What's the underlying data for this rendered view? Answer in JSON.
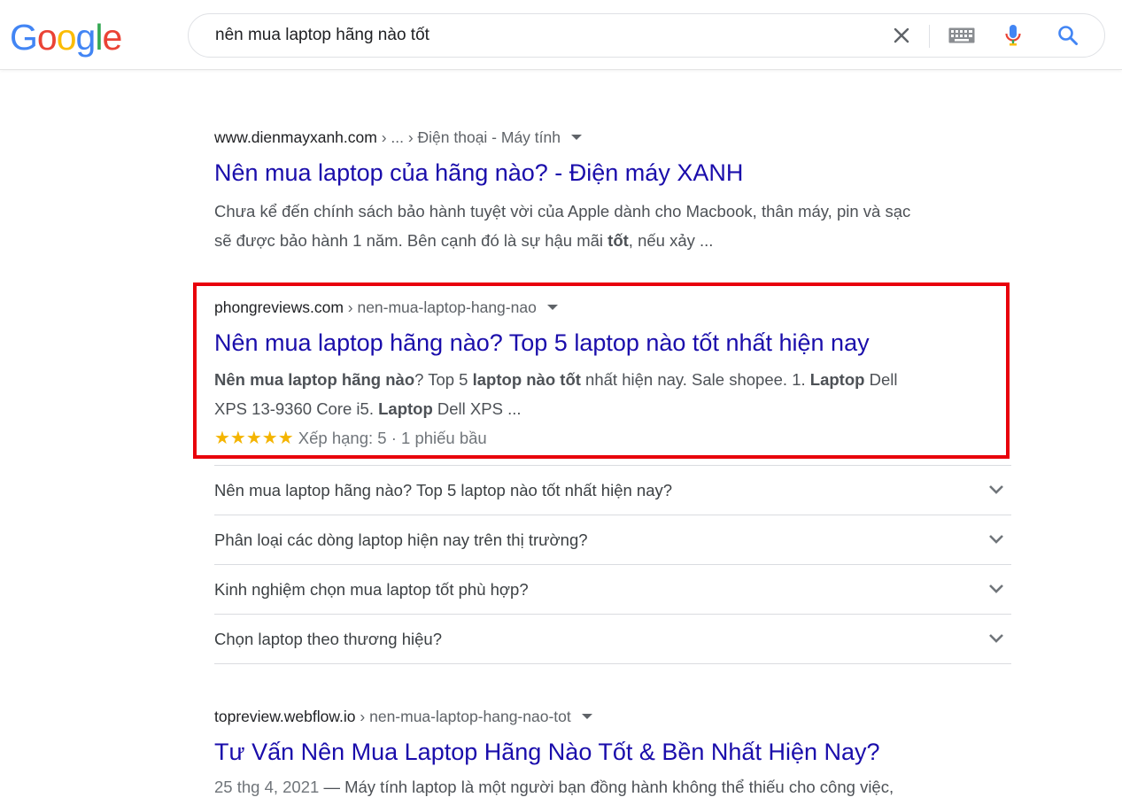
{
  "header": {
    "logo": [
      "G",
      "o",
      "o",
      "g",
      "l",
      "e"
    ],
    "logo_colors": [
      "#4285F4",
      "#EA4335",
      "#FBBC05",
      "#4285F4",
      "#34A853",
      "#EA4335"
    ],
    "query": "nên mua laptop hãng nào tốt"
  },
  "results": [
    {
      "site": "www.dienmayxanh.com",
      "path": " › ... › Điện thoại - Máy tính",
      "title": "Nên mua laptop của hãng nào? - Điện máy XANH",
      "snippet_line1": "Chưa kể đến chính sách bảo hành tuyệt vời của Apple dành cho Macbook, thân máy, pin và sạc",
      "snippet_line2_a": "sẽ được bảo hành 1 năm. Bên cạnh đó là sự hậu mãi ",
      "snippet_line2_b": "tốt",
      "snippet_line2_c": ", nếu xảy ..."
    },
    {
      "site": "phongreviews.com",
      "path": " › nen-mua-laptop-hang-nao",
      "title": "Nên mua laptop hãng nào? Top 5 laptop nào tốt nhất hiện nay",
      "s1": "Nên mua laptop hãng nào",
      "s2": "? Top 5 ",
      "s3": "laptop nào tốt",
      "s4": " nhất hiện nay. Sale shopee. 1. ",
      "s5": "Laptop",
      "s6": " Dell",
      "s7": "XPS 13-9360 Core i5. ",
      "s8": "Laptop",
      "s9": " Dell XPS ...",
      "stars": "★★★★★",
      "rating": " Xếp hạng: 5 · 1 phiếu bầu"
    },
    {
      "site": "topreview.webflow.io",
      "path": " › nen-mua-laptop-hang-nao-tot",
      "title": "Tư Vấn Nên Mua Laptop Hãng Nào Tốt & Bền Nhất Hiện Nay?",
      "date": "25 thg 4, 2021",
      "snippet": " — Máy tính laptop là một người bạn đồng hành không thể thiếu cho công việc,"
    }
  ],
  "faq": [
    "Nên mua laptop hãng nào? Top 5 laptop nào tốt nhất hiện nay?",
    "Phân loại các dòng laptop hiện nay trên thị trường?",
    "Kinh nghiệm chọn mua laptop tốt phù hợp?",
    "Chọn laptop theo thương hiệu?"
  ],
  "colors": {
    "link": "#1a0dab",
    "highlight": "#e8000b",
    "star": "#f4b400"
  },
  "icons": [
    "clear-icon",
    "keyboard-icon",
    "mic-icon",
    "search-icon",
    "chevron-down-icon",
    "dropdown-caret-icon"
  ]
}
